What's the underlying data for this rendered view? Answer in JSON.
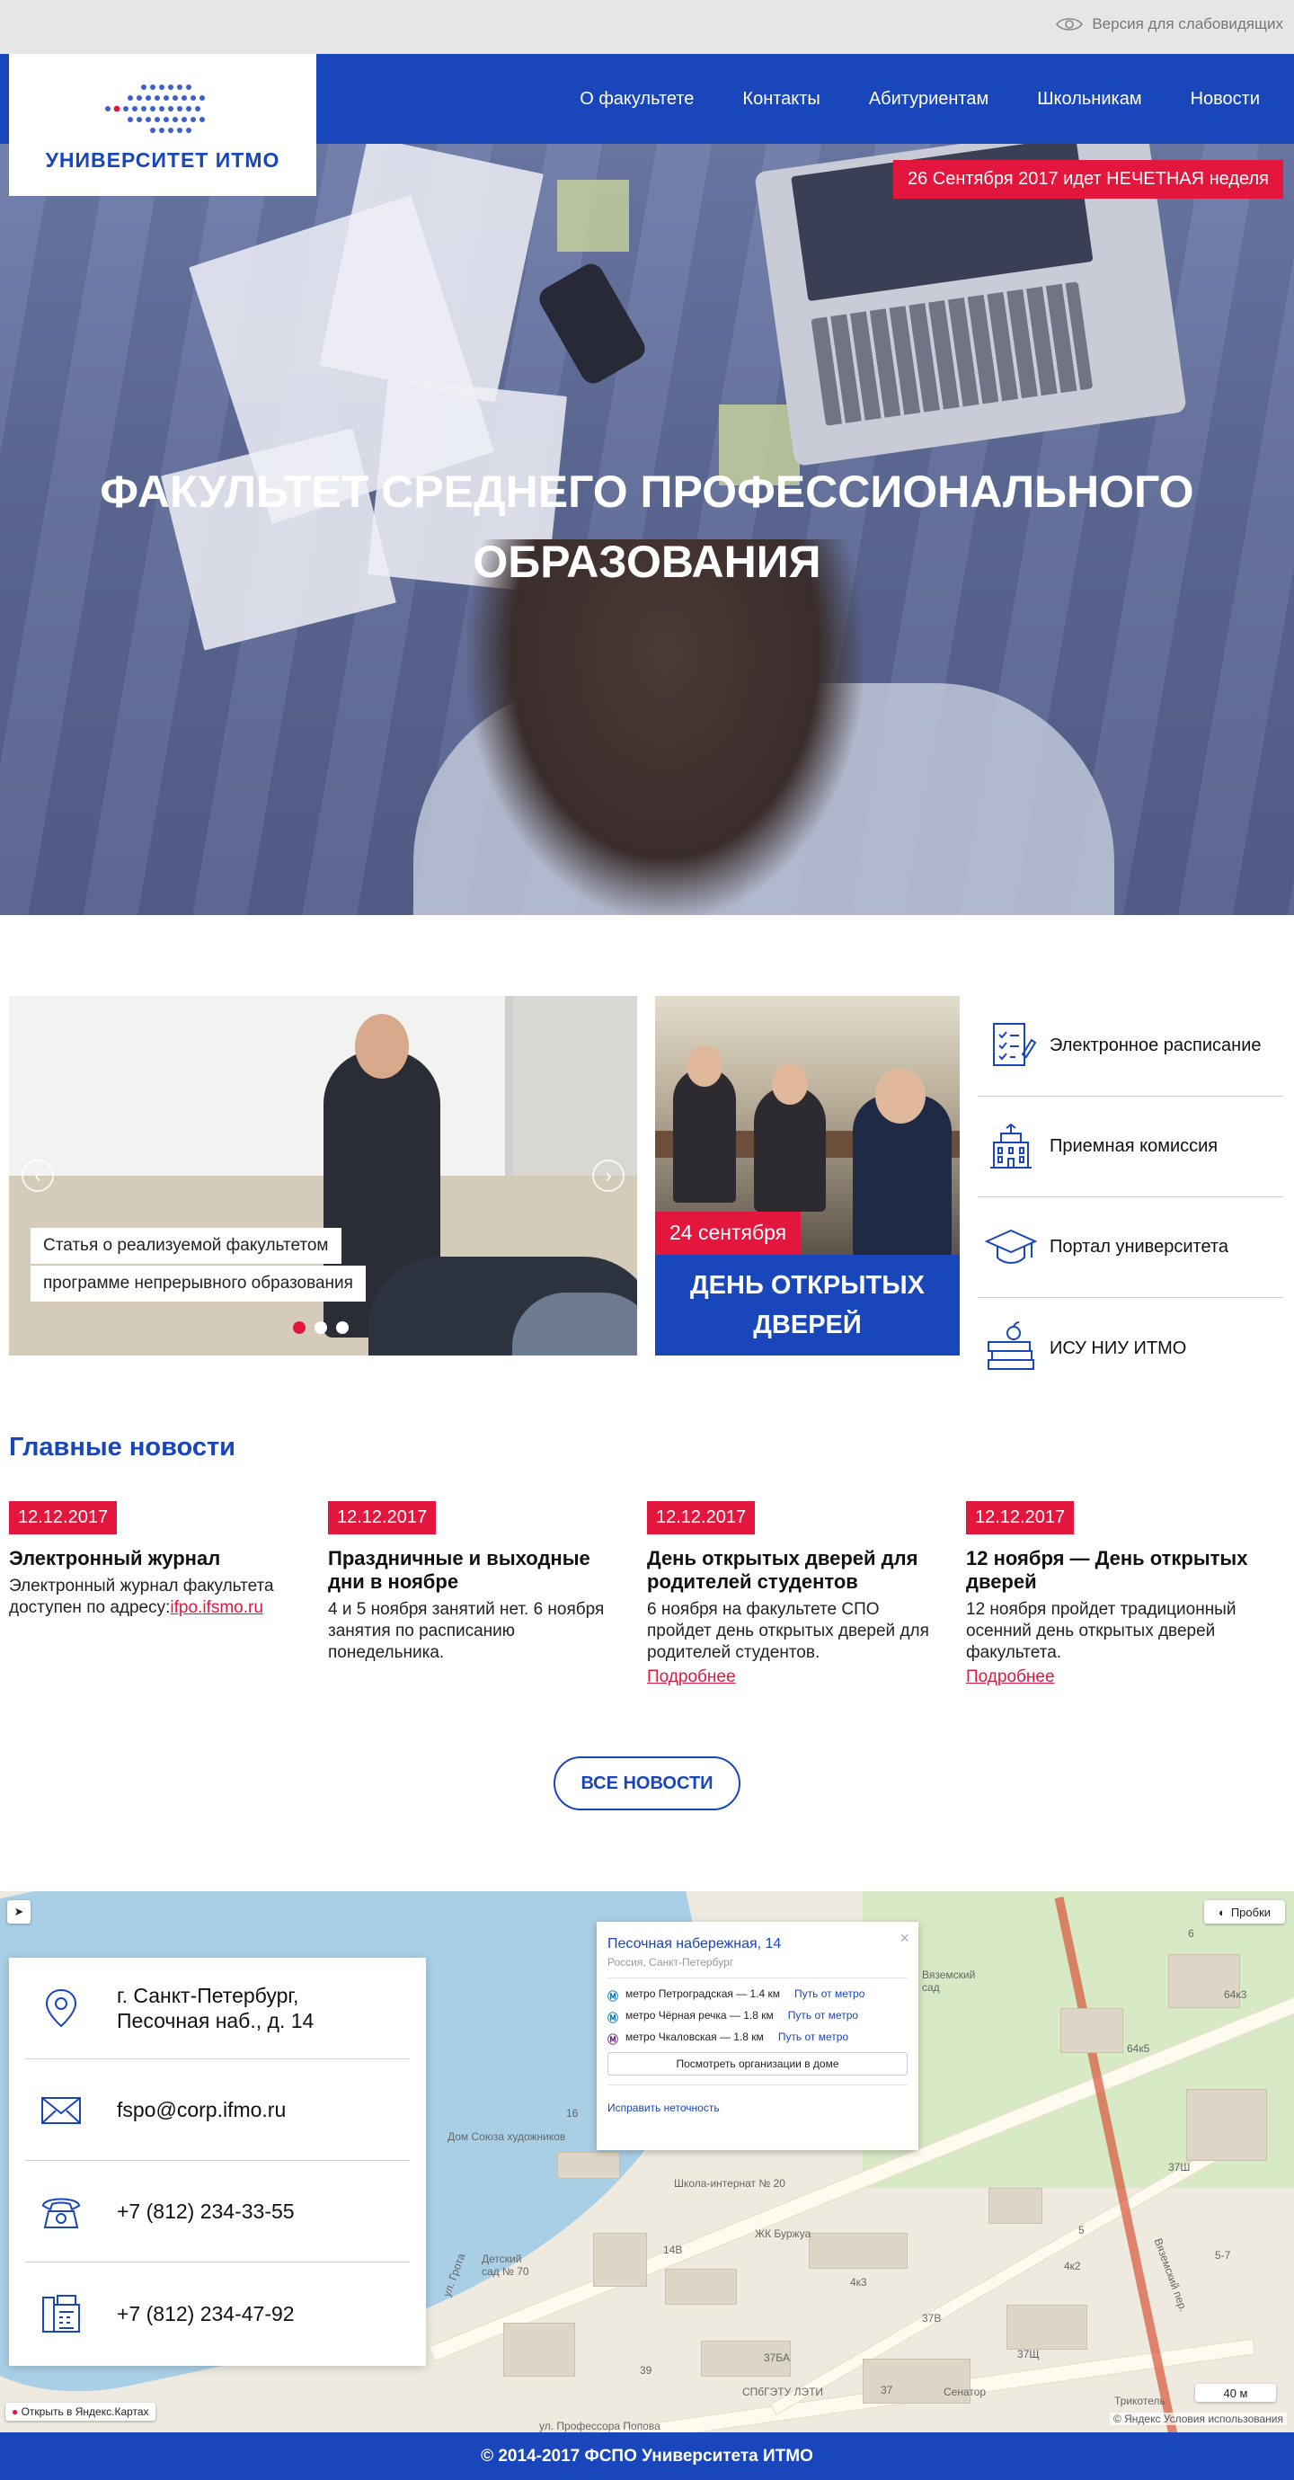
{
  "topbar": {
    "accessibility_label": "Версия для слабовидящих",
    "accessibility_icon": "eye-icon"
  },
  "logo": {
    "text": "УНИВЕРСИТЕТ ИТМО"
  },
  "nav": {
    "items": [
      {
        "label": "О факультете"
      },
      {
        "label": "Контакты"
      },
      {
        "label": "Абитуриентам"
      },
      {
        "label": "Школьникам"
      },
      {
        "label": "Новости"
      }
    ]
  },
  "hero": {
    "week_badge": "26 Сентября 2017 идет НЕЧЕТНАЯ неделя",
    "title_line1": "ФАКУЛЬТЕТ СРЕДНЕГО ПРОФЕССИОНАЛЬНОГО",
    "title_line2": "ОБРАЗОВАНИЯ"
  },
  "slider": {
    "caption_line1": "Статья о реализуемой факультетом",
    "caption_line2": "программе непрерывного образования",
    "prev_icon": "chevron-left-icon",
    "next_icon": "chevron-right-icon",
    "slides_count": 3,
    "active_slide": 1
  },
  "open_day": {
    "date": "24 сентября",
    "title_line1": "ДЕНЬ ОТКРЫТЫХ",
    "title_line2": "ДВЕРЕЙ"
  },
  "quick_links": [
    {
      "label": "Электронное расписание",
      "icon": "schedule-icon"
    },
    {
      "label": "Приемная комиссия",
      "icon": "building-icon"
    },
    {
      "label": "Портал университета",
      "icon": "graduation-cap-icon"
    },
    {
      "label": "ИСУ НИУ ИТМО",
      "icon": "books-apple-icon"
    }
  ],
  "news": {
    "heading": "Главные новости",
    "items": [
      {
        "date": "12.12.2017",
        "title": "Электронный журнал",
        "text": "Электронный журнал факультета доступен по адресу:",
        "link": "ifpo.ifsmo.ru",
        "more": ""
      },
      {
        "date": "12.12.2017",
        "title": "Праздничные и выходные дни в ноябре",
        "text": "4 и 5 ноября занятий нет. 6 ноября занятия по расписанию понедельника.",
        "link": "",
        "more": ""
      },
      {
        "date": "12.12.2017",
        "title": "День открытых дверей для родителей студентов",
        "text": "6 ноября на факультете СПО пройдет день открытых дверей для родителей студентов.",
        "link": "",
        "more": "Подробнее"
      },
      {
        "date": "12.12.2017",
        "title": "12 ноября — День открытых дверей",
        "text": "12 ноября пройдет традиционный осенний день открытых дверей факультета.",
        "link": "",
        "more": "Подробнее"
      }
    ],
    "all_button": "ВСЕ НОВОСТИ"
  },
  "map": {
    "balloon": {
      "title": "Песочная набережная, 14",
      "subtitle": "Россия, Санкт-Петербург",
      "metro": [
        {
          "station": "метро Петроградская — 1.4 км",
          "link": "Путь от метро",
          "color": "#0078c9"
        },
        {
          "station": "метро Чёрная речка — 1.8 км",
          "link": "Путь от метро",
          "color": "#0078c9"
        },
        {
          "station": "метро Чкаловская — 1.8 км",
          "link": "Путь от метро",
          "color": "#702785"
        }
      ],
      "orgs_button": "Посмотреть организации в доме",
      "fix_link": "Исправить неточность"
    },
    "traffic_label": "Пробки",
    "open_in_yandex": "Открыть в Яндекс.Картах",
    "scale": "40 м",
    "terms": "© Яндекс Условия использования",
    "labels": {
      "dom_soyuza": "Дом Союза художников",
      "shkola": "Школа-интернат № 20",
      "zhk": "ЖК Буржуа",
      "vyazemsky": "Вяземский сад",
      "sad": "Детский сад № 70",
      "senator": "Сенатор",
      "spbgetu": "СПбГЭТУ ЛЭТИ",
      "trikotel": "Трикотель",
      "professora": "ул. Профессора Попова",
      "grota": "ул. Грота",
      "vyaz_per": "Вяземский пер.",
      "num_16": "16",
      "num_14b": "14В",
      "num_4k3": "4к3",
      "num_37v": "37В",
      "num_37a": "37А",
      "num_37sch": "37Щ",
      "num_39": "39",
      "num_37": "37",
      "num_5": "5",
      "num_4k2": "4к2",
      "num_5_7": "5-7",
      "num_64k3": "64к3",
      "num_64k5": "64к5",
      "num_6": "6",
      "num_37bA": "37БА",
      "num_37sch2": "37Ш"
    }
  },
  "contacts": [
    {
      "icon": "location-pin-icon",
      "line1": "г. Санкт-Петербург,",
      "line2": "Песочная наб., д. 14"
    },
    {
      "icon": "envelope-icon",
      "line1": "fspo@corp.ifmo.ru",
      "line2": ""
    },
    {
      "icon": "telephone-icon",
      "line1": "+7 (812) 234-33-55",
      "line2": ""
    },
    {
      "icon": "fax-icon",
      "line1": "+7 (812) 234-47-92",
      "line2": ""
    }
  ],
  "footer": {
    "text": "© 2014-2017 ФСПО Университета ИТМО"
  },
  "colors": {
    "brand_blue": "#1946ba",
    "accent_red": "#e3173e"
  }
}
